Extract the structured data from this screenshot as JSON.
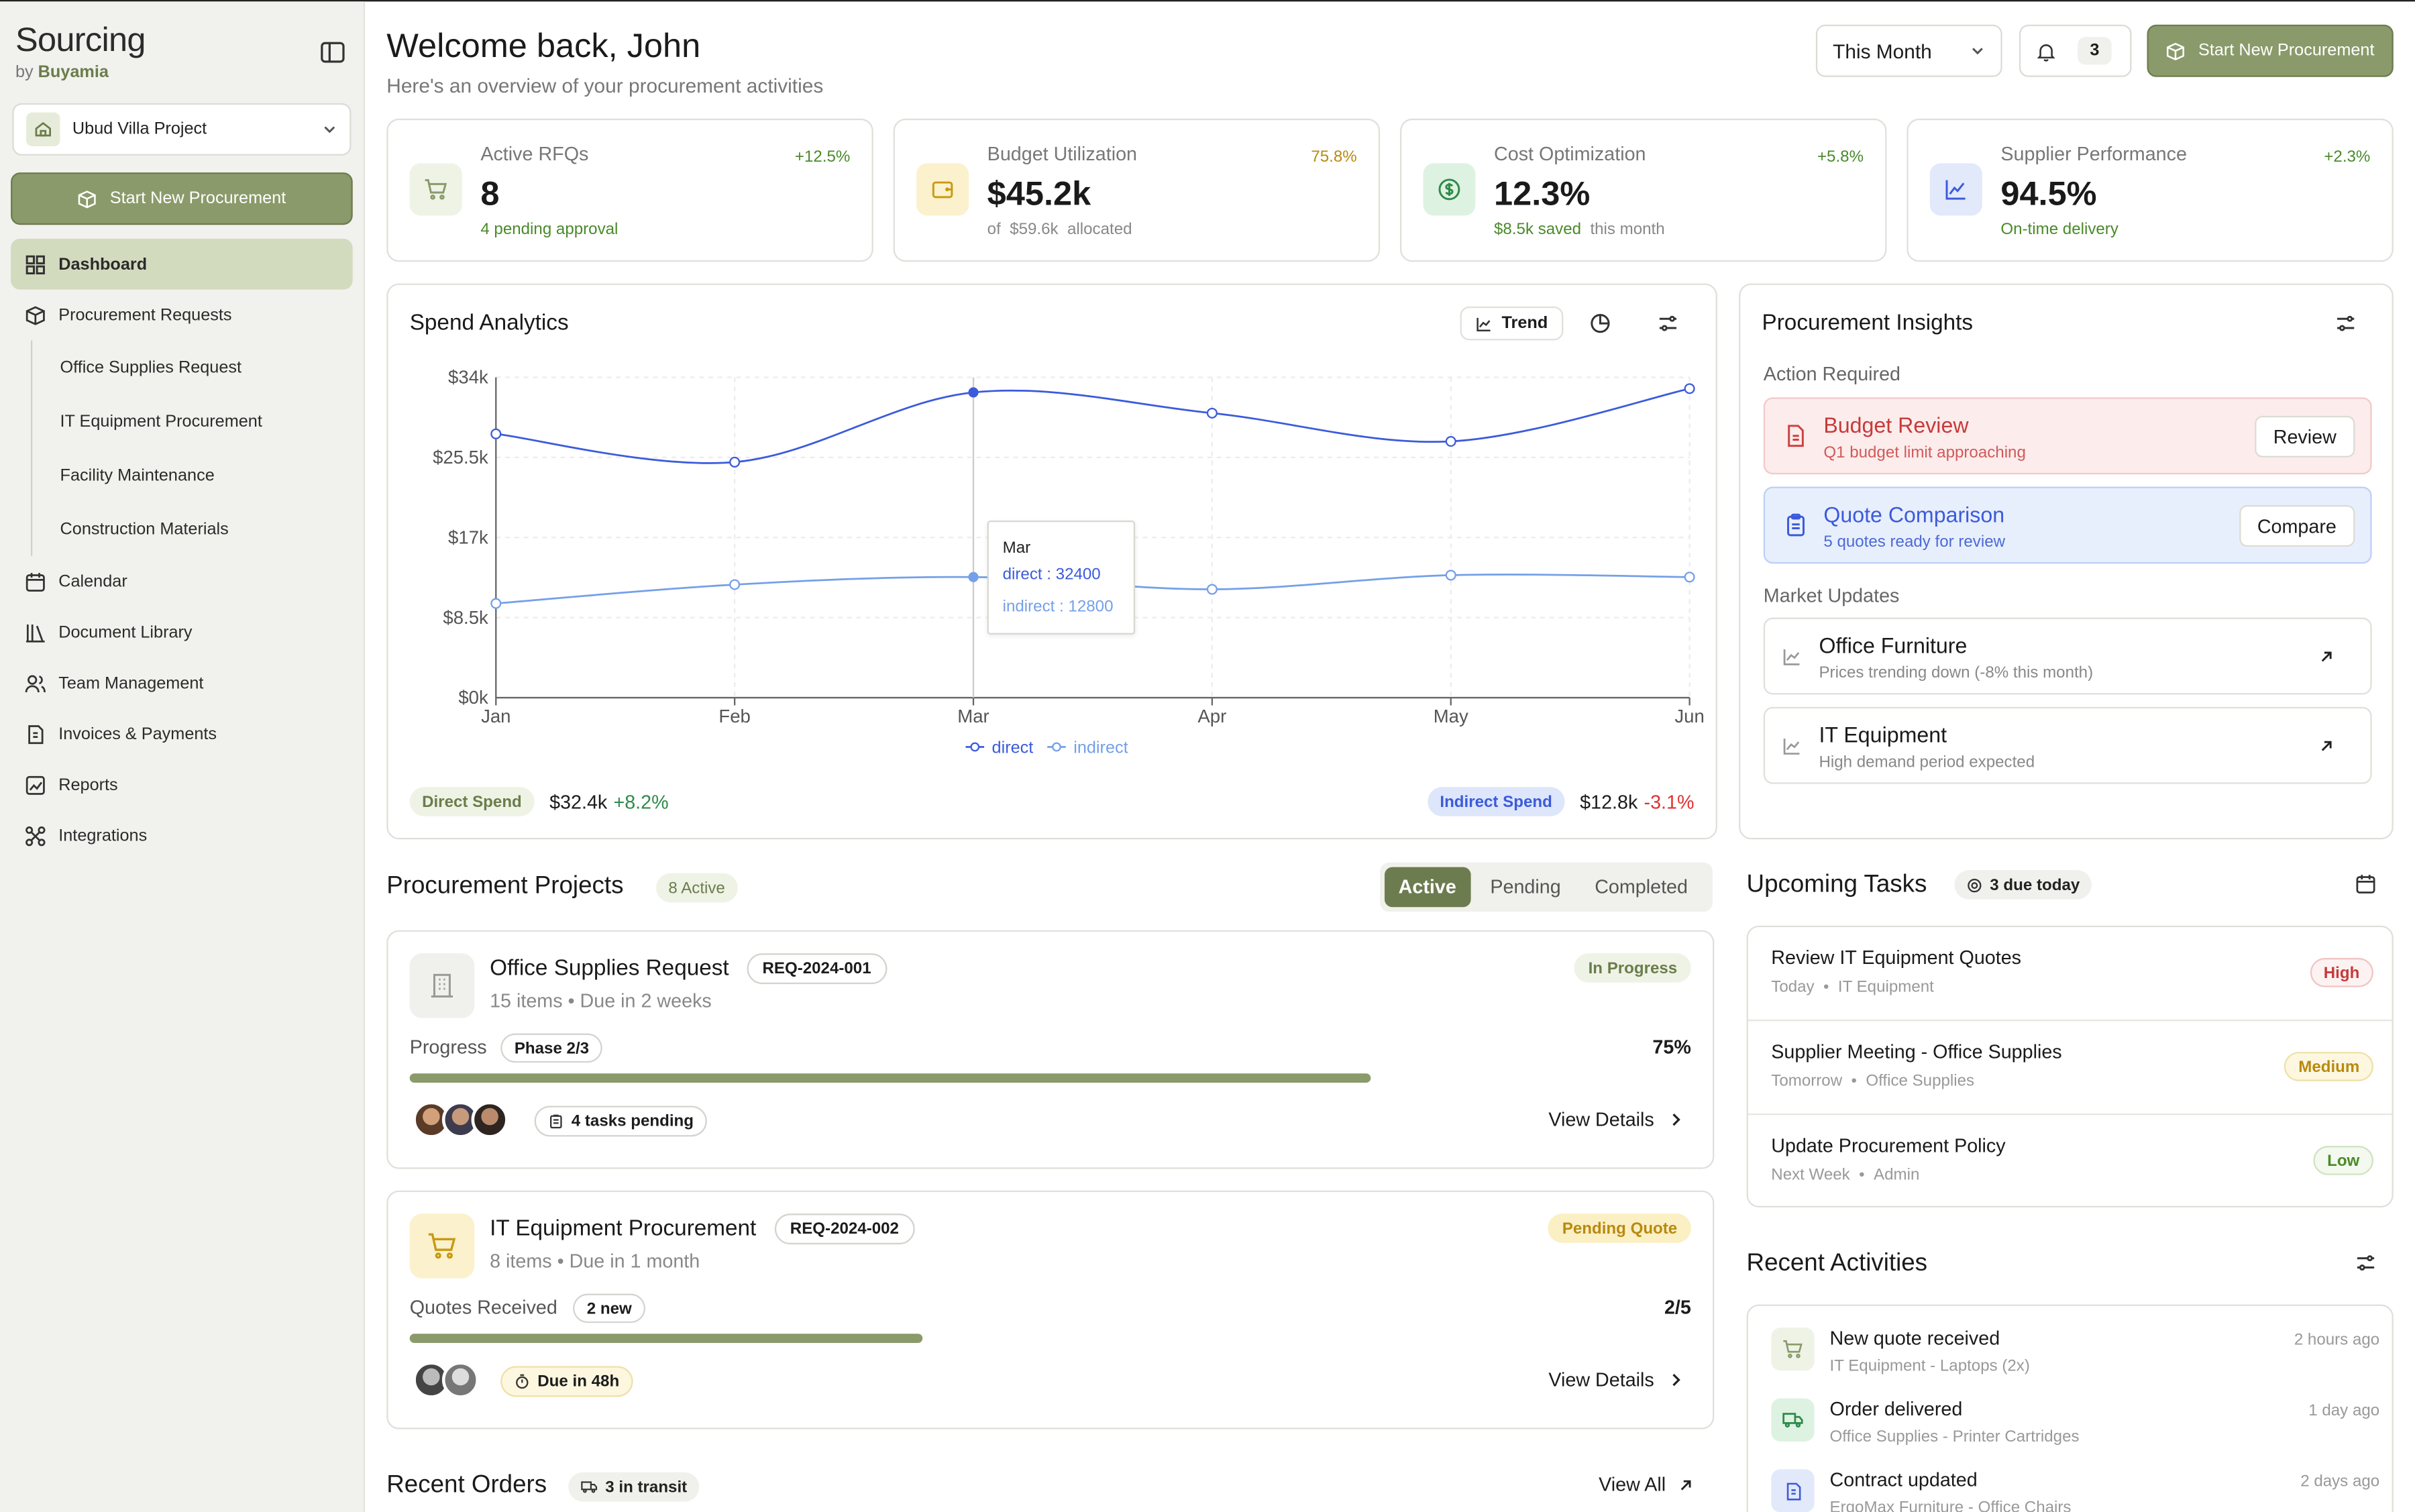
{
  "sidebar": {
    "brand": "Sourcing",
    "brand_by": "by",
    "brand_company": "Buyamia",
    "project": "Ubud Villa Project",
    "cta": "Start New Procurement",
    "nav": {
      "dashboard": "Dashboard",
      "procurement_requests": "Procurement Requests",
      "sub": [
        "Office Supplies Request",
        "IT Equipment Procurement",
        "Facility Maintenance",
        "Construction Materials"
      ],
      "calendar": "Calendar",
      "document_library": "Document Library",
      "team_management": "Team Management",
      "invoices": "Invoices & Payments",
      "reports": "Reports",
      "integrations": "Integrations"
    }
  },
  "header": {
    "title": "Welcome back, John",
    "subtitle": "Here's an overview of your procurement activities",
    "period": "This Month",
    "notifications": "3",
    "cta": "Start New Procurement"
  },
  "stats": [
    {
      "label": "Active RFQs",
      "value": "8",
      "sub": "4 pending approval",
      "change": "+12.5%"
    },
    {
      "label": "Budget Utilization",
      "value": "$45.2k",
      "sub_prefix": "of",
      "sub_amount": "$59.6k",
      "sub_suffix": "allocated",
      "change": "75.8%"
    },
    {
      "label": "Cost Optimization",
      "value": "12.3%",
      "sub_saved": "$8.5k saved",
      "sub_suffix": "this month",
      "change": "+5.8%"
    },
    {
      "label": "Supplier Performance",
      "value": "94.5%",
      "sub": "On-time delivery",
      "change": "+2.3%"
    }
  ],
  "spend": {
    "title": "Spend Analytics",
    "trend_label": "Trend",
    "tooltip": {
      "month": "Mar",
      "direct": "direct : 32400",
      "indirect": "indirect : 12800"
    },
    "direct_label": "Direct Spend",
    "direct_value": "$32.4k",
    "direct_change": "+8.2%",
    "indirect_label": "Indirect Spend",
    "indirect_value": "$12.8k",
    "indirect_change": "-3.1%"
  },
  "chart_data": {
    "type": "line",
    "x": [
      "Jan",
      "Feb",
      "Mar",
      "Apr",
      "May",
      "Jun"
    ],
    "y_ticks": [
      "$0k",
      "$8.5k",
      "$17k",
      "$25.5k",
      "$34k"
    ],
    "ylim": [
      0,
      34000
    ],
    "series": [
      {
        "name": "direct",
        "values": [
          28000,
          25000,
          32400,
          30200,
          27200,
          32800
        ],
        "color": "#3b5bdb"
      },
      {
        "name": "indirect",
        "values": [
          10000,
          12000,
          12800,
          11500,
          13000,
          12800
        ],
        "color": "#74a0e8"
      }
    ],
    "legend": "bottom",
    "grid": true
  },
  "insights": {
    "title": "Procurement Insights",
    "action_label": "Action Required",
    "budget_title": "Budget Review",
    "budget_sub": "Q1 budget limit approaching",
    "budget_btn": "Review",
    "quote_title": "Quote Comparison",
    "quote_sub": "5 quotes ready for review",
    "quote_btn": "Compare",
    "market_label": "Market Updates",
    "m1_title": "Office Furniture",
    "m1_sub": "Prices trending down (-8% this month)",
    "m2_title": "IT Equipment",
    "m2_sub": "High demand period expected"
  },
  "projects": {
    "title": "Procurement Projects",
    "active_count": "8 Active",
    "tabs": [
      "Active",
      "Pending",
      "Completed"
    ],
    "p1": {
      "name": "Office Supplies Request",
      "id": "REQ-2024-001",
      "meta": "15 items • Due in 2 weeks",
      "status": "In Progress",
      "prog_label": "Progress",
      "phase": "Phase 2/3",
      "value": "75%",
      "progress": 0.75,
      "tasks": "4 tasks pending",
      "view": "View Details"
    },
    "p2": {
      "name": "IT Equipment Procurement",
      "id": "REQ-2024-002",
      "meta": "8 items • Due in 1 month",
      "status": "Pending Quote",
      "prog_label": "Quotes Received",
      "phase": "2 new",
      "value": "2/5",
      "progress": 0.4,
      "tasks": "Due in 48h",
      "view": "View Details"
    }
  },
  "orders": {
    "title": "Recent Orders",
    "transit": "3 in transit",
    "view_all": "View All"
  },
  "tasks": {
    "title": "Upcoming Tasks",
    "due": "3 due today",
    "items": [
      {
        "title": "Review IT Equipment Quotes",
        "when": "Today",
        "cat": "IT Equipment",
        "prio": "High"
      },
      {
        "title": "Supplier Meeting - Office Supplies",
        "when": "Tomorrow",
        "cat": "Office Supplies",
        "prio": "Medium"
      },
      {
        "title": "Update Procurement Policy",
        "when": "Next Week",
        "cat": "Admin",
        "prio": "Low"
      }
    ]
  },
  "activities": {
    "title": "Recent Activities",
    "items": [
      {
        "title": "New quote received",
        "sub": "IT Equipment - Laptops (2x)",
        "time": "2 hours ago"
      },
      {
        "title": "Order delivered",
        "sub": "Office Supplies - Printer Cartridges",
        "time": "1 day ago"
      },
      {
        "title": "Contract updated",
        "sub": "ErgoMax Furniture - Office Chairs",
        "time": "2 days ago"
      }
    ]
  }
}
